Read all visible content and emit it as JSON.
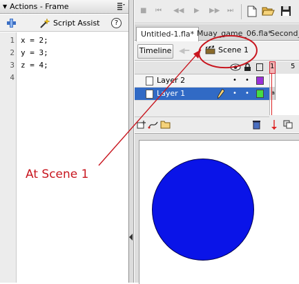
{
  "actions_panel": {
    "title": "Actions - Frame",
    "script_assist_label": "Script Assist",
    "help_label": "?",
    "line_numbers": [
      "1",
      "2",
      "3",
      "4"
    ],
    "code_lines": [
      "x = 2;",
      "y = 3;",
      "z = 4;",
      ""
    ]
  },
  "document_tabs": [
    "Untitled-1.fla*",
    "Muay_game_06.fla*",
    "Second_"
  ],
  "edit_bar": {
    "timeline_label": "Timeline",
    "scene_label": "Scene 1"
  },
  "timeline": {
    "frame_number": "1",
    "frame_number_5": "5",
    "layers": [
      {
        "name": "Layer 2",
        "selected": false,
        "color": "#9b30d8"
      },
      {
        "name": "Layer 1",
        "selected": true,
        "color": "#44dd44"
      }
    ]
  },
  "stage": {
    "shape": "circle",
    "fill_color": "#0a14e8"
  },
  "annotation": {
    "text": "At Scene 1",
    "color": "#c8161f"
  }
}
